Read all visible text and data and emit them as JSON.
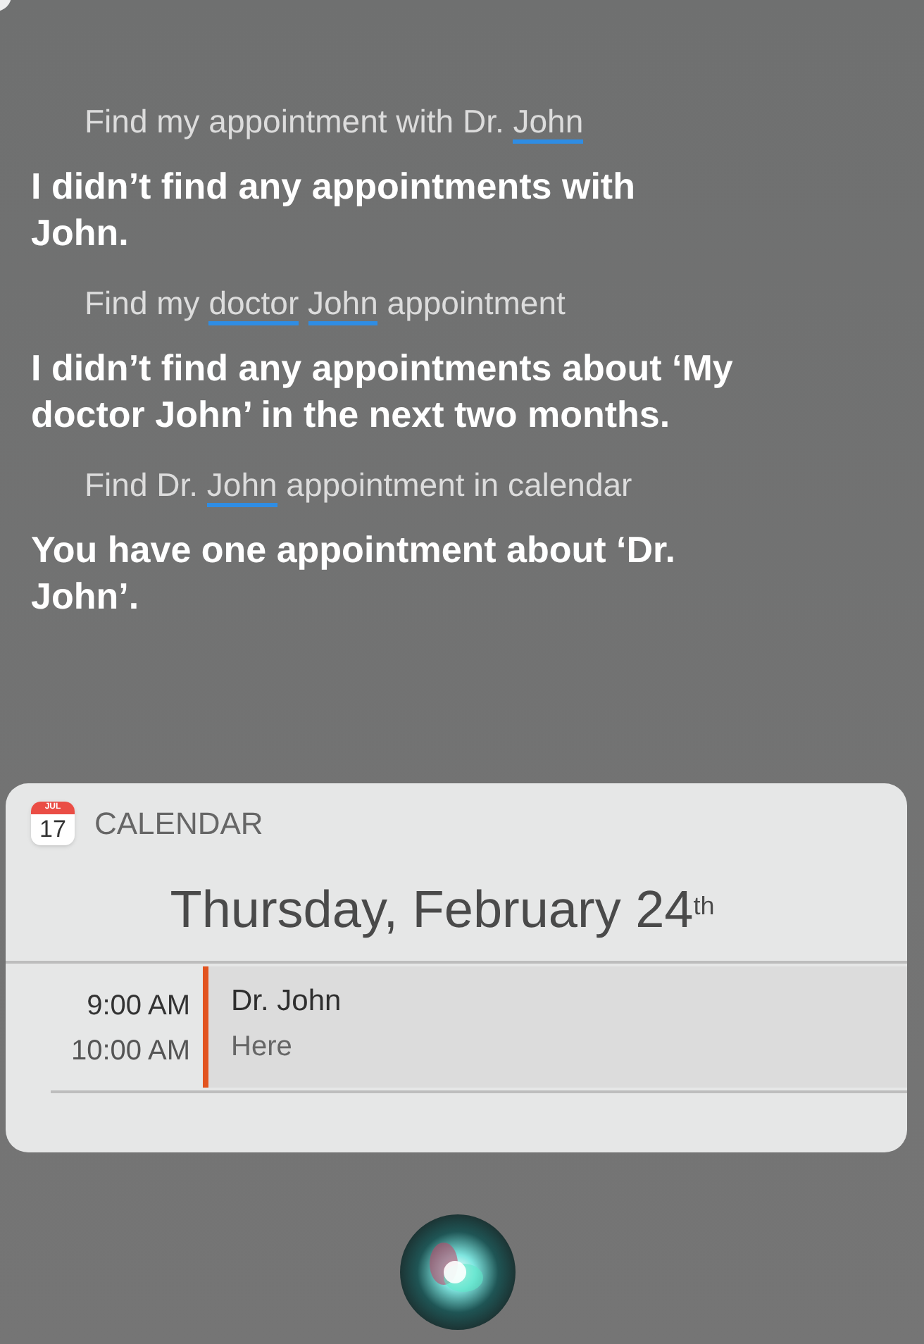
{
  "conversation": [
    {
      "kind": "query",
      "segments": [
        {
          "text": "Find my appointment with Dr. ",
          "underlined": false
        },
        {
          "text": "John",
          "underlined": true
        }
      ]
    },
    {
      "kind": "response",
      "lines": [
        "I didn’t find any appointments with",
        "John."
      ]
    },
    {
      "kind": "query",
      "segments": [
        {
          "text": "Find my ",
          "underlined": false
        },
        {
          "text": "doctor",
          "underlined": true
        },
        {
          "text": " John",
          "underlined": true
        },
        {
          "text": " appointment",
          "underlined": false
        }
      ]
    },
    {
      "kind": "response",
      "lines": [
        "I didn’t find any appointments about ‘My",
        "doctor John’ in the next two months."
      ]
    },
    {
      "kind": "query",
      "segments": [
        {
          "text": "Find Dr. ",
          "underlined": false
        },
        {
          "text": "John",
          "underlined": true
        },
        {
          "text": " appointment in calendar",
          "underlined": false
        }
      ]
    },
    {
      "kind": "response",
      "lines": [
        "You have one appointment about ‘Dr.",
        "John’."
      ]
    }
  ],
  "calendar_card": {
    "icon_month": "JUL",
    "icon_day": "17",
    "app_name": "CALENDAR",
    "date": "Thursday, February 24$^{th}$",
    "events": [
      {
        "start": "9:00 AM",
        "end": "10:00 AM",
        "title": "Dr. John",
        "location": "Here",
        "color": "#e2531f"
      }
    ]
  }
}
